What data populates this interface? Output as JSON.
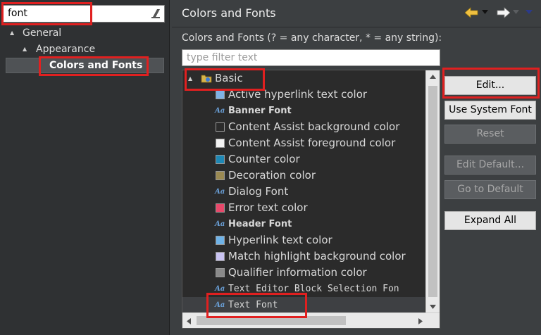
{
  "sidebar": {
    "filter_value": "font",
    "tree": [
      {
        "label": "General"
      },
      {
        "label": "Appearance"
      },
      {
        "label": "Colors and Fonts"
      }
    ]
  },
  "page": {
    "title": "Colors and Fonts",
    "description": "Colors and Fonts (? = any character, * = any string):",
    "filter_placeholder": "type filter text"
  },
  "tree": {
    "category": "Basic",
    "items": [
      {
        "label": "Active hyperlink text color",
        "kind": "color",
        "color": "#7fb2e5"
      },
      {
        "label": "Banner Font",
        "kind": "font"
      },
      {
        "label": "Content Assist background color",
        "kind": "color",
        "color": "#2b2b2b"
      },
      {
        "label": "Content Assist foreground color",
        "kind": "color",
        "color": "#f2f2f2"
      },
      {
        "label": "Counter color",
        "kind": "color",
        "color": "#1e88b5"
      },
      {
        "label": "Decoration color",
        "kind": "color",
        "color": "#9b8a52"
      },
      {
        "label": "Dialog Font",
        "kind": "font"
      },
      {
        "label": "Error text color",
        "kind": "color",
        "color": "#e8486a"
      },
      {
        "label": "Header Font",
        "kind": "font"
      },
      {
        "label": "Hyperlink text color",
        "kind": "color",
        "color": "#6fb3e8"
      },
      {
        "label": "Match highlight background color",
        "kind": "color",
        "color": "#c9c3f2"
      },
      {
        "label": "Qualifier information color",
        "kind": "color",
        "color": "#8a8a8a"
      },
      {
        "label": "Text Editor Block Selection Fon",
        "kind": "font"
      },
      {
        "label": "Text Font",
        "kind": "font"
      }
    ]
  },
  "buttons": {
    "edit": "Edit...",
    "use_system_font": "Use System Font",
    "reset": "Reset",
    "edit_default": "Edit Default...",
    "go_to_default": "Go to Default",
    "expand_all": "Expand All"
  },
  "colors": {
    "highlight_box": "#e02020",
    "nav_arrow": "#f0c040"
  }
}
